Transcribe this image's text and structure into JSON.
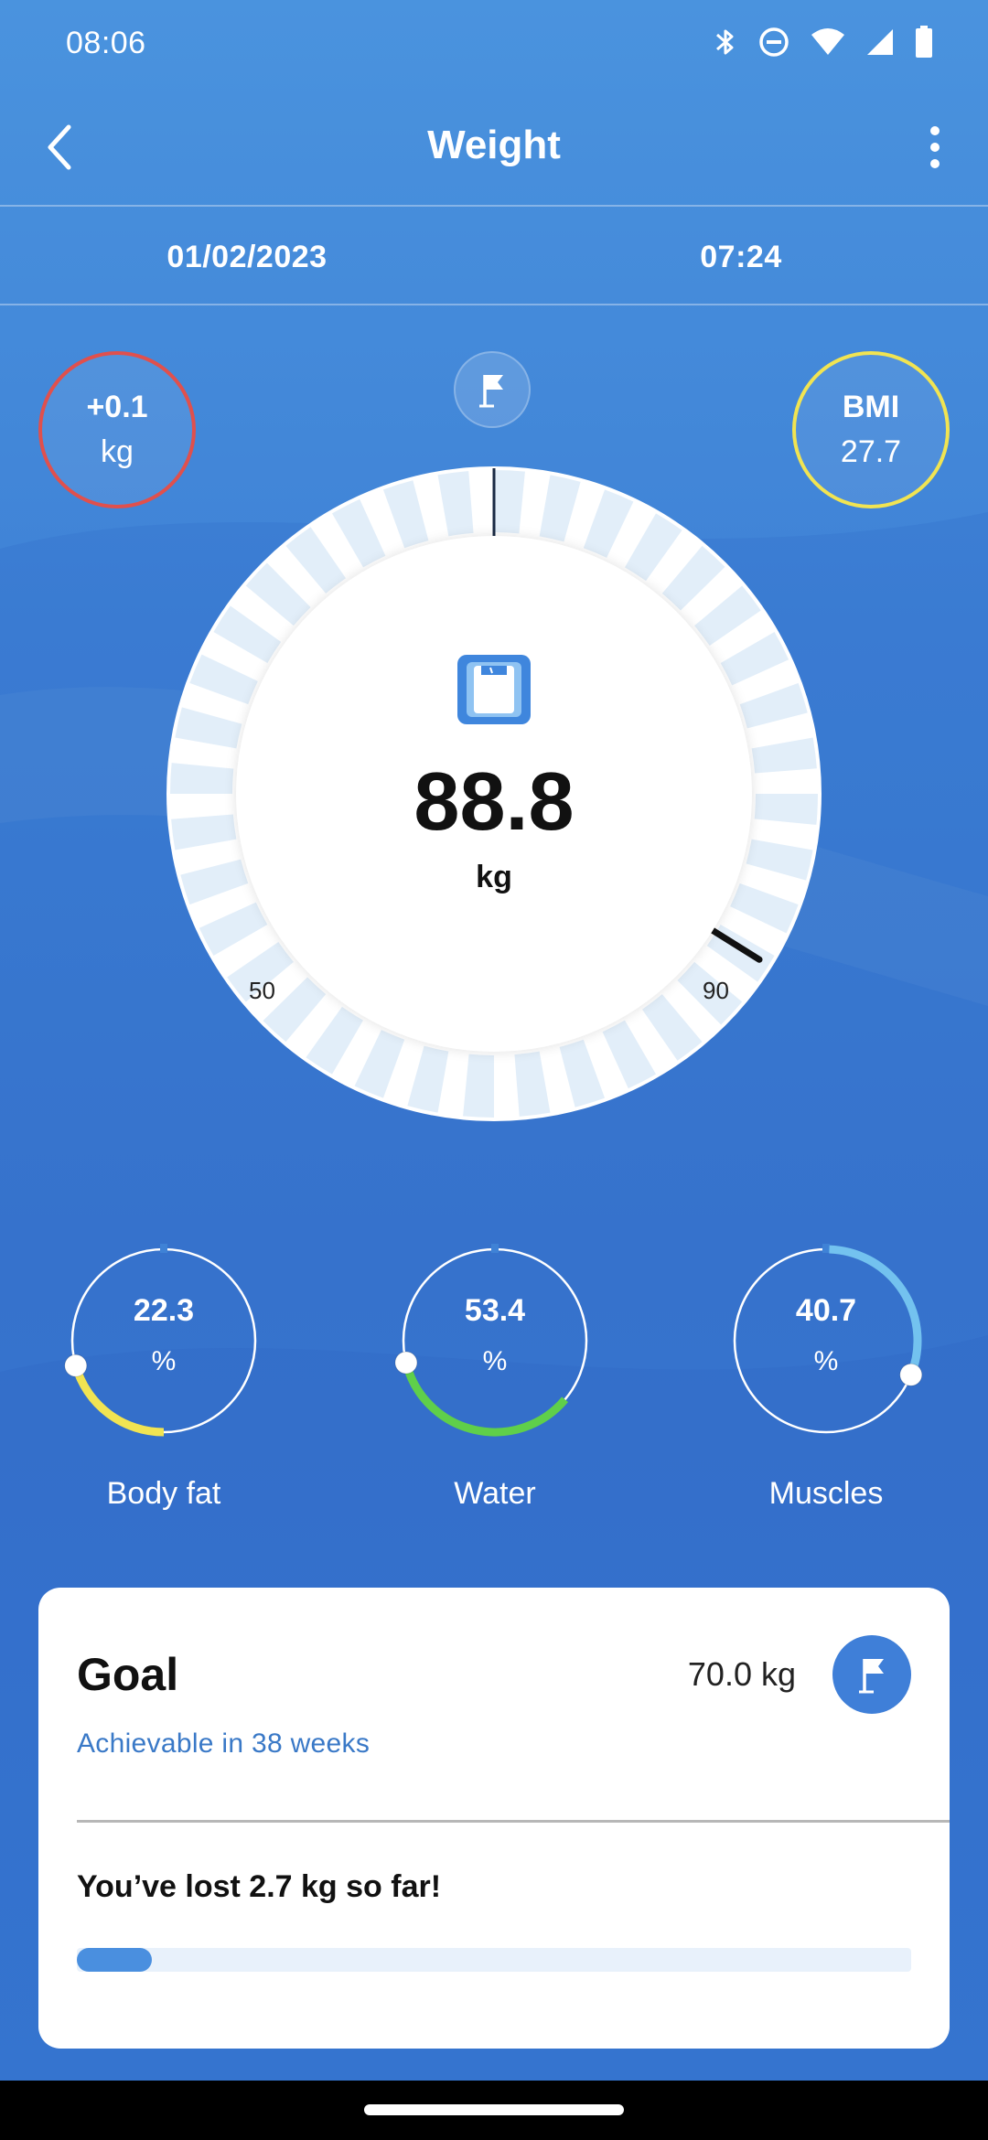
{
  "status_bar": {
    "time": "08:06",
    "icons": [
      "bluetooth-icon",
      "dnd-icon",
      "wifi-icon",
      "signal-icon",
      "battery-icon"
    ]
  },
  "app_bar": {
    "title": "Weight",
    "back_icon": "back-arrow-icon",
    "menu_icon": "more-vert-icon"
  },
  "measurement": {
    "date": "01/02/2023",
    "time": "07:24"
  },
  "badges": {
    "change_value": "+0.1",
    "change_unit": "kg",
    "bmi_label": "BMI",
    "bmi_value": "27.7"
  },
  "gauge": {
    "value": "88.8",
    "unit": "kg",
    "min_label": "50",
    "max_label": "90",
    "goal_icon": "flag-icon",
    "scale_icon": "scale-icon"
  },
  "composition": [
    {
      "value": "22.3",
      "unit": "%",
      "label": "Body fat",
      "color": "#f1e452"
    },
    {
      "value": "53.4",
      "unit": "%",
      "label": "Water",
      "color": "#5fcf4a"
    },
    {
      "value": "40.7",
      "unit": "%",
      "label": "Muscles",
      "color": "#73c2ef"
    }
  ],
  "goal": {
    "title": "Goal",
    "target": "70.0 kg",
    "eta": "Achievable in 38 weeks",
    "progress_text": "You’ve lost 2.7 kg so far!",
    "progress_fraction": 0.09,
    "accent": "#3f7fd8"
  }
}
